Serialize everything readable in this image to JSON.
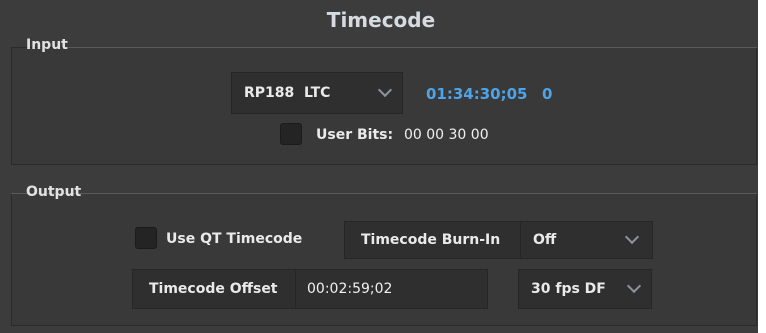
{
  "window": {
    "title": "Timecode"
  },
  "input": {
    "section_label": "Input",
    "source_select": {
      "value": "RP188  LTC"
    },
    "timecode_value": "01:34:30;05",
    "frame_field": "0",
    "user_bits": {
      "label": "User Bits:",
      "value": "00 00 30 00",
      "checked": false
    }
  },
  "output": {
    "section_label": "Output",
    "use_qt_timecode": {
      "label": "Use QT Timecode",
      "checked": false
    },
    "burn_in": {
      "label": "Timecode Burn-In",
      "value": "Off"
    },
    "offset": {
      "label": "Timecode Offset",
      "value": "00:02:59;02"
    },
    "fps_select": {
      "value": "30 fps DF"
    }
  },
  "colors": {
    "timecode_blue": "#4ea4e8",
    "panel_bg": "#3c3c3c",
    "control_bg": "#2f2f2f",
    "text": "#eaeaea"
  },
  "icons": [
    "chevron-down-icon",
    "checkbox-icon"
  ]
}
